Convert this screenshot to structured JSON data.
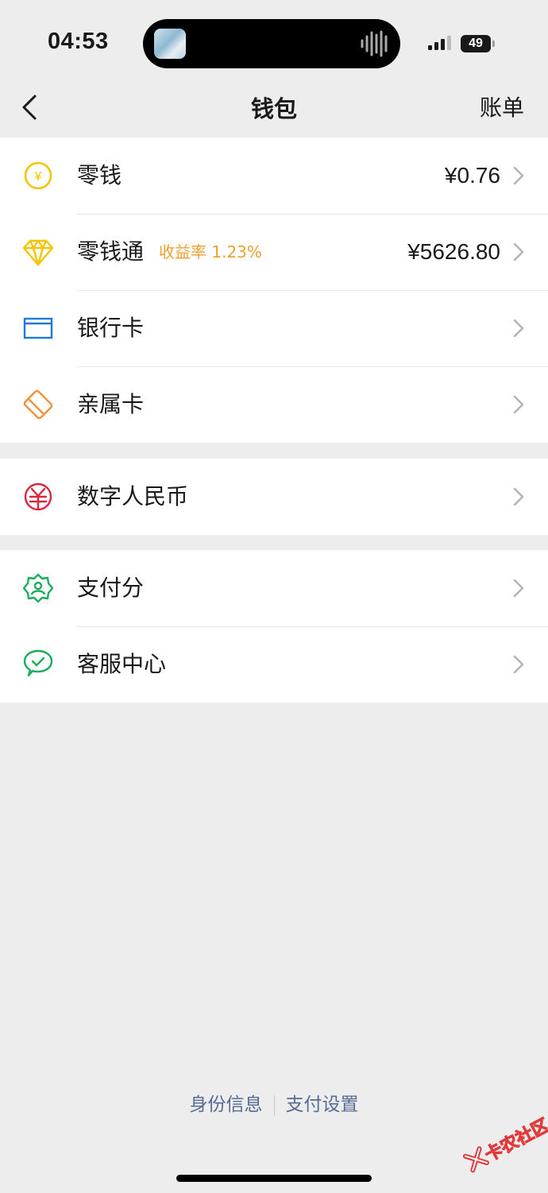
{
  "status_bar": {
    "time": "04:53",
    "battery": "49"
  },
  "nav": {
    "title": "钱包",
    "action": "账单"
  },
  "groups": [
    {
      "items": [
        {
          "label": "零钱",
          "value": "¥0.76",
          "icon": "yuan-coin-icon",
          "color": "#f5c400"
        },
        {
          "label": "零钱通",
          "tag": "收益率 1.23%",
          "value": "¥5626.80",
          "icon": "diamond-icon",
          "color": "#f5c400"
        },
        {
          "label": "银行卡",
          "icon": "bank-card-icon",
          "color": "#1f7ad6"
        },
        {
          "label": "亲属卡",
          "icon": "family-card-icon",
          "color": "#f0913a"
        }
      ]
    },
    {
      "items": [
        {
          "label": "数字人民币",
          "icon": "digital-rmb-icon",
          "color": "#d8263c"
        }
      ]
    },
    {
      "items": [
        {
          "label": "支付分",
          "icon": "pay-score-icon",
          "color": "#1aad5a"
        },
        {
          "label": "客服中心",
          "icon": "customer-service-icon",
          "color": "#1aad5a"
        }
      ]
    }
  ],
  "footer": {
    "links": [
      "身份信息",
      "支付设置"
    ]
  },
  "watermark": "卡农社区",
  "colors": {
    "background": "#ededed",
    "link": "#576b95",
    "tag": "#f0a032"
  }
}
